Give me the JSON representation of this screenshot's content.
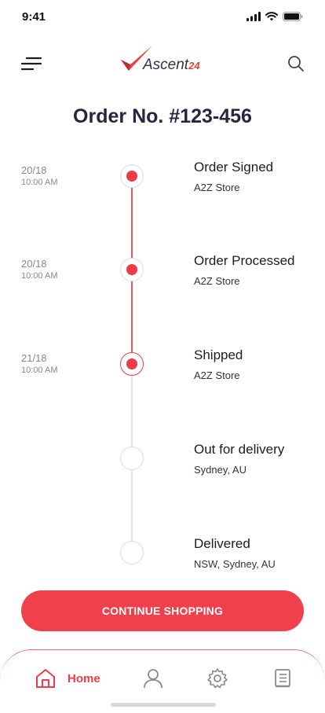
{
  "status_bar": {
    "time": "9:41"
  },
  "header": {
    "logo_text": "Ascent",
    "logo_number": "24"
  },
  "title": "Order No. #123-456",
  "timeline": [
    {
      "date": "20/18",
      "time": "10:00 AM",
      "title": "Order Signed",
      "location": "A2Z Store",
      "state": "done"
    },
    {
      "date": "20/18",
      "time": "10:00 AM",
      "title": "Order Processed",
      "location": "A2Z Store",
      "state": "done"
    },
    {
      "date": "21/18",
      "time": "10:00 AM",
      "title": "Shipped",
      "location": "A2Z Store",
      "state": "current"
    },
    {
      "date": "",
      "time": "",
      "title": "Out for delivery",
      "location": "Sydney, AU",
      "state": "pending"
    },
    {
      "date": "",
      "time": "",
      "title": "Delivered",
      "location": "NSW, Sydney, AU",
      "state": "pending"
    }
  ],
  "cta_label": "CONTINUE SHOPPING",
  "bottom_nav": {
    "home_label": "Home",
    "active_color": "#ef3b47"
  },
  "colors": {
    "accent": "#ef3b47",
    "title": "#2b2340"
  }
}
